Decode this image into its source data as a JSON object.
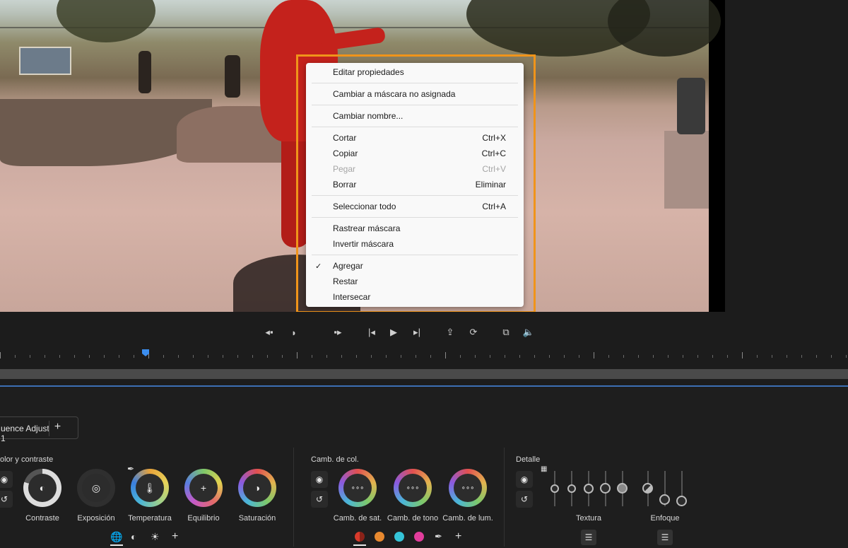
{
  "context_menu": {
    "items": [
      {
        "label": "Editar propiedades",
        "shortcut": "",
        "enabled": true,
        "checked": false
      },
      {
        "label": "Cambiar a máscara no asignada",
        "shortcut": "",
        "enabled": true,
        "checked": false
      },
      {
        "label": "Cambiar nombre...",
        "shortcut": "",
        "enabled": true,
        "checked": false
      },
      {
        "label": "Cortar",
        "shortcut": "Ctrl+X",
        "enabled": true,
        "checked": false
      },
      {
        "label": "Copiar",
        "shortcut": "Ctrl+C",
        "enabled": true,
        "checked": false
      },
      {
        "label": "Pegar",
        "shortcut": "Ctrl+V",
        "enabled": false,
        "checked": false
      },
      {
        "label": "Borrar",
        "shortcut": "Eliminar",
        "enabled": true,
        "checked": false
      },
      {
        "label": "Seleccionar todo",
        "shortcut": "Ctrl+A",
        "enabled": true,
        "checked": false
      },
      {
        "label": "Rastrear máscara",
        "shortcut": "",
        "enabled": true,
        "checked": false
      },
      {
        "label": "Invertir máscara",
        "shortcut": "",
        "enabled": true,
        "checked": false
      },
      {
        "label": "Agregar",
        "shortcut": "",
        "enabled": true,
        "checked": true
      },
      {
        "label": "Restar",
        "shortcut": "",
        "enabled": true,
        "checked": false
      },
      {
        "label": "Intersecar",
        "shortcut": "",
        "enabled": true,
        "checked": false
      }
    ],
    "check_mark": "✓",
    "highlight_color": "#f0941a"
  },
  "transport": {
    "icons": [
      "mark-in-icon",
      "mark-clip-icon",
      "mark-out-icon",
      "go-to-in-icon",
      "play-icon",
      "go-to-out-icon",
      "export-frame-icon",
      "loop-icon",
      "compare-icon",
      "volume-icon"
    ]
  },
  "panel": {
    "sequence_tab": {
      "label": "uence Adjust 1",
      "add_label": "+"
    },
    "sections": {
      "color_contrast": {
        "title": "olor y contraste",
        "dials": [
          {
            "label": "Contraste"
          },
          {
            "label": "Exposición"
          },
          {
            "label": "Temperatura"
          },
          {
            "label": "Equilibrio"
          },
          {
            "label": "Saturación"
          }
        ]
      },
      "color_change": {
        "title": "Camb. de col.",
        "dials": [
          {
            "label": "Camb. de sat."
          },
          {
            "label": "Camb. de tono"
          },
          {
            "label": "Camb. de lum."
          }
        ],
        "swatches": [
          "#d93a2b",
          "#e8892f",
          "#35c4d8",
          "#e23d9c"
        ]
      },
      "detail": {
        "title": "Detalle",
        "groups": [
          {
            "label": "Textura"
          },
          {
            "label": "Enfoque"
          }
        ]
      }
    },
    "add_label": "+"
  }
}
